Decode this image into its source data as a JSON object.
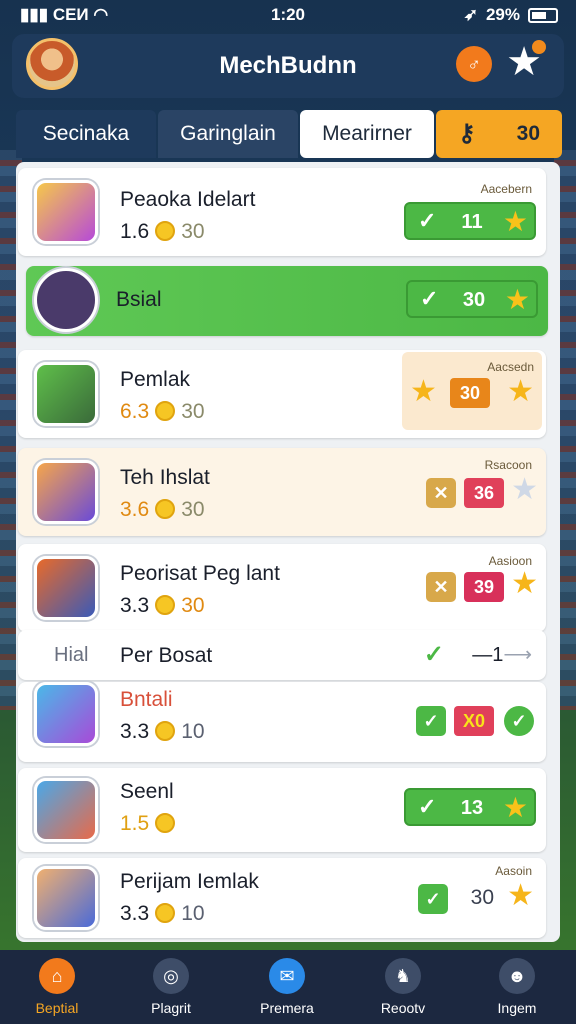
{
  "status": {
    "carrier": "CEИ",
    "time": "1:20",
    "battery": "29%"
  },
  "header": {
    "title": "MechBudnn"
  },
  "tabs": [
    {
      "label": "Secinaka"
    },
    {
      "label": "Garinglain"
    },
    {
      "label": "Mearirner"
    },
    {
      "label": "30"
    }
  ],
  "rows": [
    {
      "name": "Peaoka Idelart",
      "score": "1.6",
      "coins": "30",
      "tag": "Aacebern",
      "badge": "11"
    },
    {
      "name": "Bsial",
      "badge": "30"
    },
    {
      "name": "Pemlak",
      "score": "6.3",
      "coins": "30",
      "tag": "Aacsedn",
      "badge": "30"
    },
    {
      "name": "Teh Ihslat",
      "score": "3.6",
      "coins": "30",
      "tag": "Rsacoon",
      "badge": "36"
    },
    {
      "name": "Peorisat Peg lant",
      "score": "3.3",
      "coins": "30",
      "tag": "Aasioon",
      "badge": "39"
    },
    {
      "name": "Per Bosat",
      "side": "Hial",
      "arrow": "1"
    },
    {
      "name": "Bntali",
      "score": "3.3",
      "coins": "10",
      "badge": "X0"
    },
    {
      "name": "Seenl",
      "score": "1.5",
      "badge": "13"
    },
    {
      "name": "Perijam Iemlak",
      "score": "3.3",
      "coins": "10",
      "tag": "Aasoin",
      "badge": "30"
    }
  ],
  "nav": [
    {
      "label": "Beptial"
    },
    {
      "label": "Plagrit"
    },
    {
      "label": "Premera"
    },
    {
      "label": "Reootv"
    },
    {
      "label": "Ingem"
    }
  ]
}
